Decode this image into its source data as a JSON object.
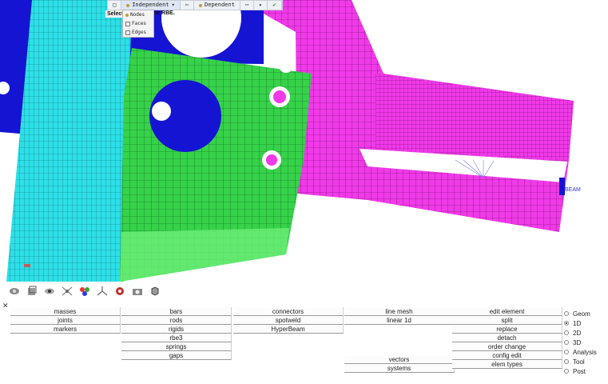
{
  "context_bar": {
    "independent_label": "Independent",
    "dependent_label": "Dependent",
    "more_symbol": "⋯",
    "play_symbol": "▸",
    "ok_symbol": "✔"
  },
  "select_prompt": {
    "label": "Select",
    "hint": "ine RBE."
  },
  "dropdown": {
    "items": [
      "Nodes",
      "Faces",
      "Edges"
    ]
  },
  "viewport": {
    "beam_label": "BEAM"
  },
  "colors": {
    "cyan_part": "#2ee0e8",
    "green_part": "#36d24a",
    "magenta_part": "#f03ae8",
    "blue_part": "#1414d2"
  },
  "toolbar": {
    "icons": [
      "shaded-view-icon",
      "box-view-icon",
      "eye-icon",
      "spider-icon",
      "color-wheel-icon",
      "axis-icon",
      "find-icon",
      "camera-icon",
      "cube-icon"
    ]
  },
  "panel": {
    "close_symbol": "✕",
    "columns": [
      [
        "masses",
        "joints",
        "markers",
        "",
        "",
        ""
      ],
      [
        "bars",
        "rods",
        "rigids",
        "rbe3",
        "springs",
        "gaps"
      ],
      [
        "connectors",
        "spotweld",
        "HyperBeam",
        "",
        "",
        ""
      ],
      [
        "line mesh",
        "linear 1d",
        "",
        "",
        "",
        ""
      ],
      [
        "",
        "",
        "",
        "",
        "vectors",
        "systems"
      ],
      [
        "edit element",
        "split",
        "replace",
        "detach",
        "order change",
        "config edit",
        "elem types"
      ]
    ],
    "radios": [
      {
        "label": "Geom",
        "selected": false
      },
      {
        "label": "1D",
        "selected": true
      },
      {
        "label": "2D",
        "selected": false
      },
      {
        "label": "3D",
        "selected": false
      },
      {
        "label": "Analysis",
        "selected": false
      },
      {
        "label": "Tool",
        "selected": false
      },
      {
        "label": "Post",
        "selected": false
      }
    ]
  }
}
